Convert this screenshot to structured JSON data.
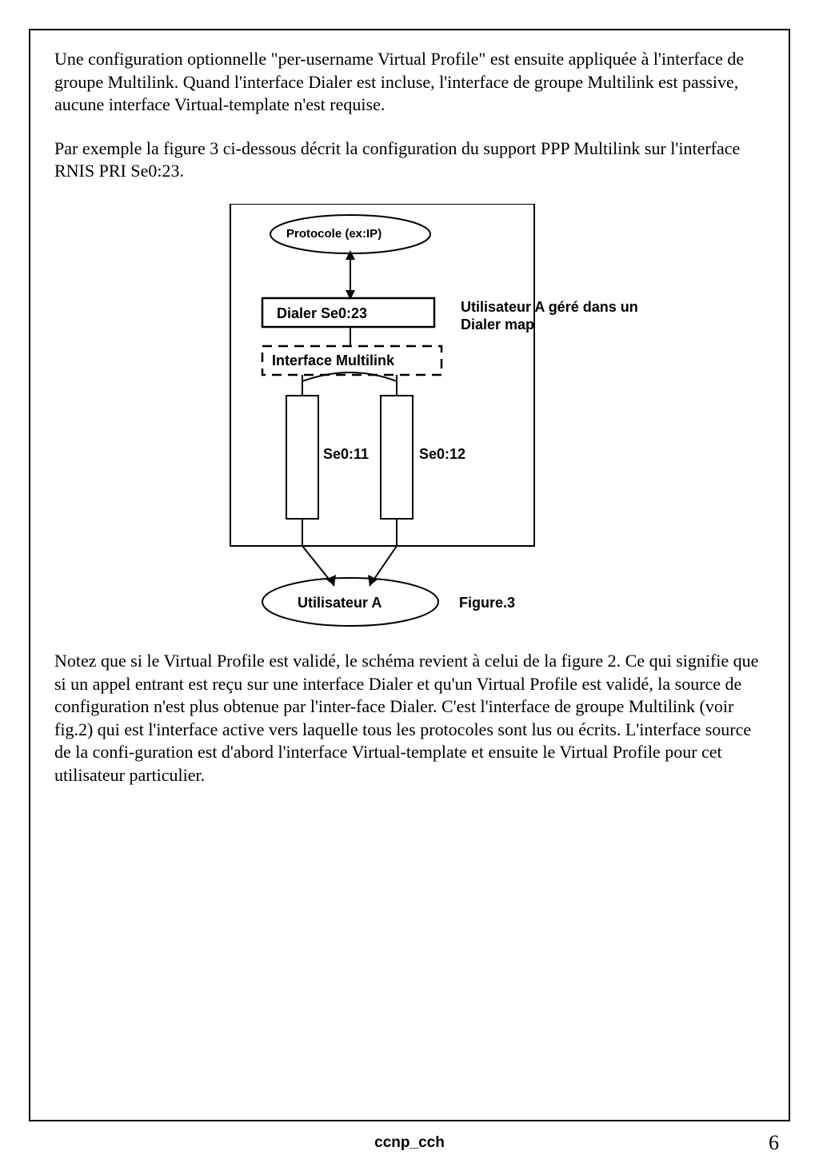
{
  "body": {
    "p1": "Une configuration optionnelle \"per-username Virtual Profile\" est ensuite appliquée à l'interface de groupe Multilink. Quand l'interface Dialer est incluse, l'interface de groupe Multilink est passive, aucune interface Virtual-template n'est requise.",
    "p2": "Par exemple la figure 3 ci-dessous décrit la configuration du support PPP Multilink sur l'interface RNIS PRI Se0:23.",
    "p3": "Notez que si le Virtual Profile est validé, le schéma revient à celui de la figure 2. Ce qui signifie que si un appel entrant est reçu sur une interface Dialer et qu'un Virtual Profile est validé, la source de configuration n'est plus obtenue par l'inter-face Dialer. C'est l'interface de groupe Multilink (voir fig.2) qui est l'interface active vers laquelle tous les protocoles sont lus ou écrits. L'interface source de la  confi-guration est d'abord l'interface Virtual-template et ensuite le Virtual Profile pour cet utilisateur particulier."
  },
  "diagram": {
    "protocol": "Protocole (ex:IP)",
    "dialer": "Dialer Se0:23",
    "multilink": "Interface Multilink",
    "se1": "Se0:11",
    "se2": "Se0:12",
    "user": "Utilisateur A",
    "note_l1": "Utilisateur A géré dans un",
    "note_l2": "Dialer map",
    "caption": "Figure.3"
  },
  "footer": {
    "doc": "ccnp_cch",
    "page": "6"
  }
}
